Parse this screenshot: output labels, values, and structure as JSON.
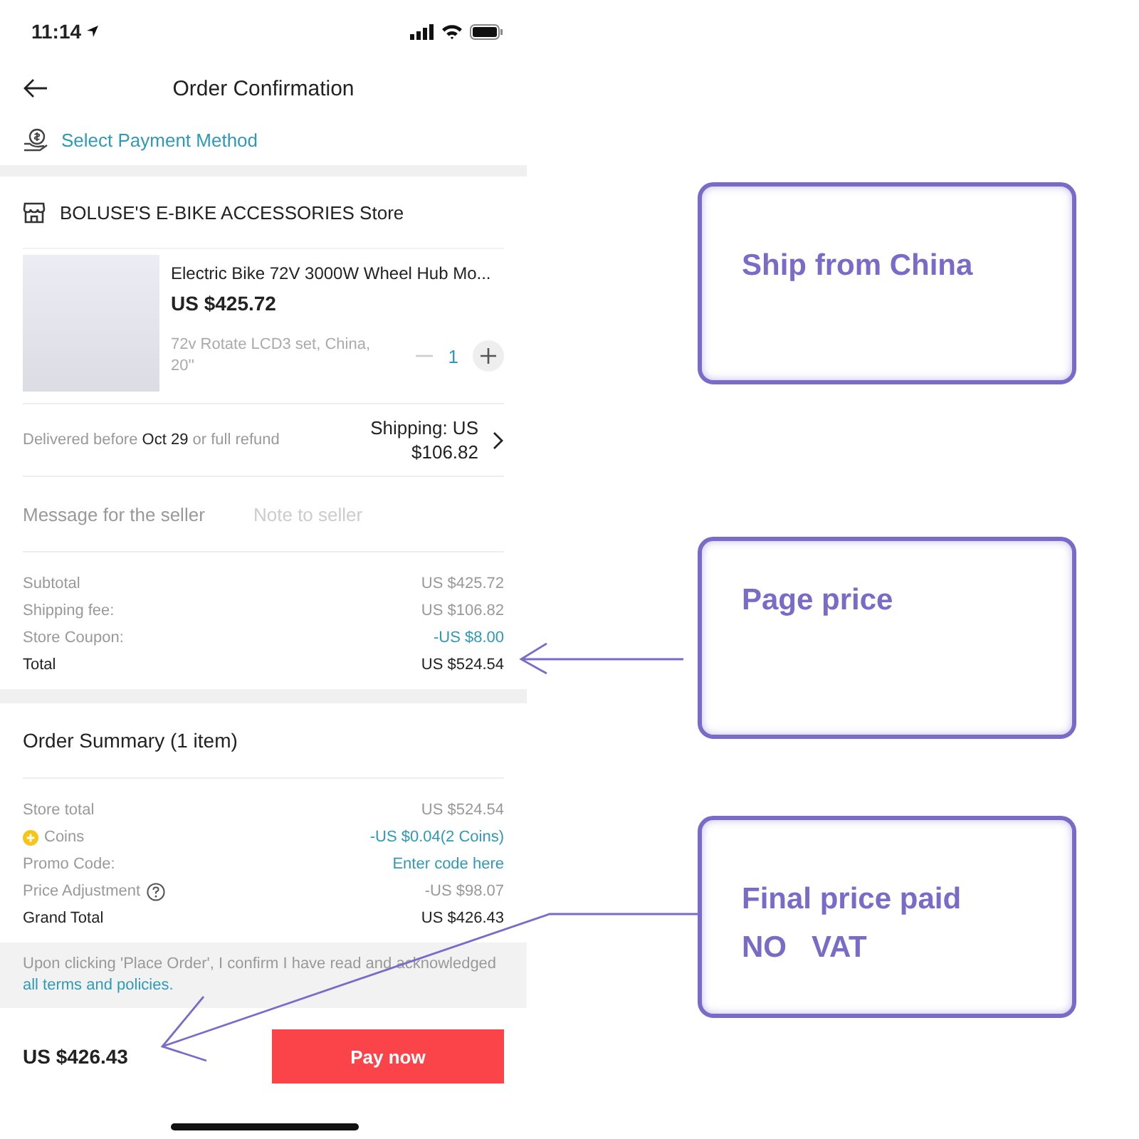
{
  "status_bar": {
    "time": "11:14"
  },
  "header": {
    "title": "Order Confirmation"
  },
  "payment": {
    "label": "Select Payment Method"
  },
  "store": {
    "name": "BOLUSE'S E-BIKE ACCESSORIES Store"
  },
  "product": {
    "title": "Electric Bike 72V 3000W Wheel Hub Mo...",
    "price": "US $425.72",
    "variant": "72v Rotate LCD3 set, China, 20''",
    "quantity": "1"
  },
  "delivery": {
    "text": "Delivered before **Oct 29** or full refund",
    "shipping": "Shipping: US $106.82"
  },
  "message": {
    "label": "Message for the seller",
    "placeholder": "Note to seller"
  },
  "store_summary": [
    {
      "label": "Subtotal",
      "value": "US $425.72",
      "kind": "plain"
    },
    {
      "label": "Shipping fee:",
      "value": "US $106.82",
      "kind": "plain"
    },
    {
      "label": "Store Coupon:",
      "value": "-US $8.00",
      "kind": "discount"
    },
    {
      "label": "Total",
      "value": "US $524.54",
      "kind": "total"
    }
  ],
  "order_summary": {
    "title": "Order Summary (1 item)",
    "rows": [
      {
        "label": "Store total",
        "value": "US $524.54",
        "kind": "plain"
      },
      {
        "label": "Coins",
        "value": "-US $0.04(2 Coins)",
        "kind": "coins"
      },
      {
        "label": "Promo Code:",
        "value": "Enter code here",
        "kind": "link"
      },
      {
        "label": "Price Adjustment",
        "value": "-US $98.07",
        "kind": "help"
      },
      {
        "label": "Grand Total",
        "value": "US $426.43",
        "kind": "total"
      }
    ]
  },
  "notice": {
    "text": "Upon clicking 'Place Order', I confirm I have read and acknowledged",
    "link": "all terms and policies."
  },
  "footer": {
    "total": "US $426.43",
    "button": "Pay now"
  },
  "annotations": [
    {
      "lines": [
        "Ship from China"
      ],
      "kind": "plain"
    },
    {
      "lines": [
        "Page price"
      ],
      "kind": "straight"
    },
    {
      "lines": [
        "Final price paid",
        "NO   VAT"
      ],
      "kind": "bent"
    }
  ]
}
